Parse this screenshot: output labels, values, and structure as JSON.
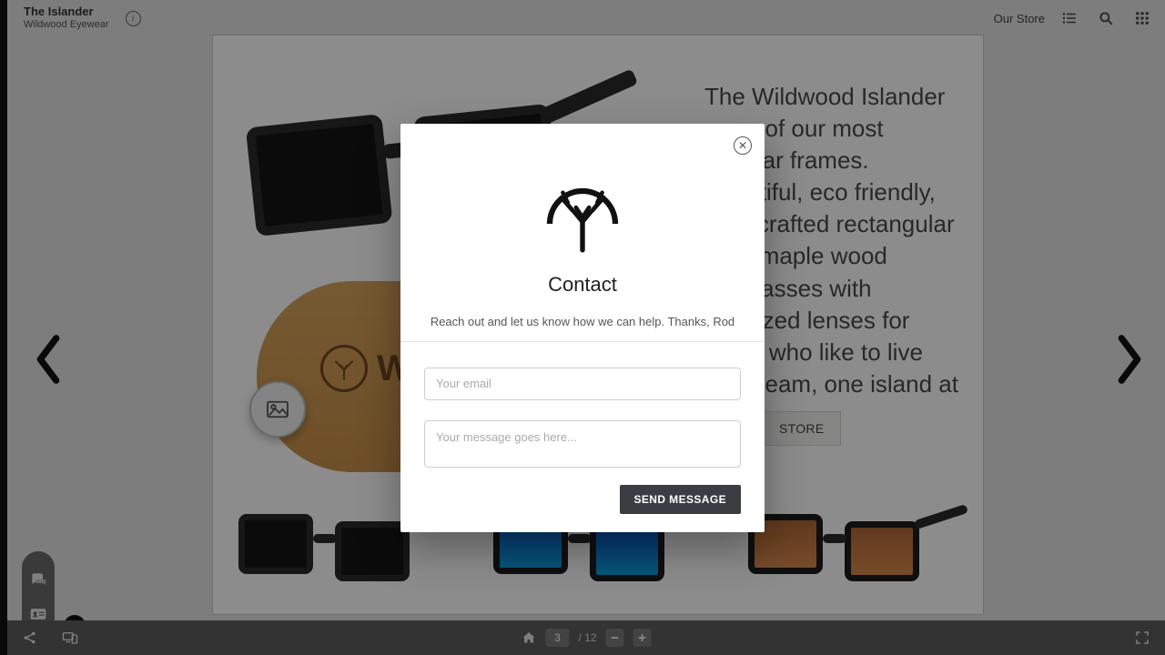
{
  "header": {
    "title": "The Islander",
    "subtitle": "Wildwood Eyewear",
    "our_store": "Our Store"
  },
  "slide": {
    "description": "The Wildwood Islander - one of our most popular frames. Beautiful, eco friendly, handcrafted rectangular style maple wood sunglasses with polarized lenses for those who like to live the dream, one island at a",
    "case_brand": "WIL",
    "store_button": "STORE"
  },
  "pagination": {
    "current": "3",
    "total_label": "/ 12"
  },
  "modal": {
    "title": "Contact",
    "description": "Reach out and let us know how we can help. Thanks, Rod",
    "email_placeholder": "Your email",
    "message_placeholder": "Your message goes here...",
    "send_label": "SEND MESSAGE"
  }
}
